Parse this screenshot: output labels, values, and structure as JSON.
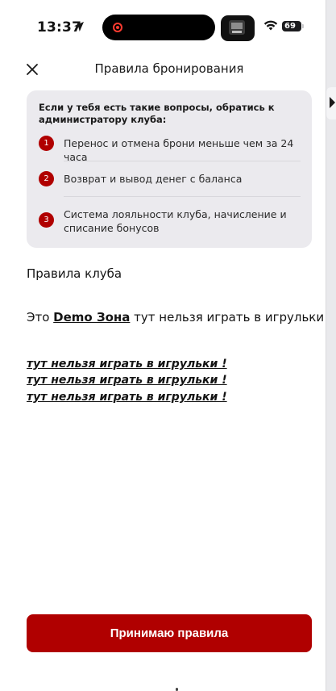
{
  "status_bar": {
    "time": "13:37",
    "battery": "69"
  },
  "header": {
    "title": "Правила бронирования"
  },
  "info_card": {
    "intro": "Если у тебя есть такие вопросы, обратись к администратору клуба:",
    "topics": [
      {
        "number": "1",
        "text": "Перенос и отмена брони меньше чем за 24 часа"
      },
      {
        "number": "2",
        "text": "Возврат и вывод денег с баланса"
      },
      {
        "number": "3",
        "text": "Система лояльности клуба, начисление и списание бонусов"
      }
    ]
  },
  "rules": {
    "heading": "Правила клуба",
    "line_prefix": "Это ",
    "club_name": "Demo Зона",
    "line_suffix": " тут нельзя играть в игрульки !",
    "emphasis_lines": [
      "тут нельзя играть в игрульки !",
      "тут нельзя играть в игрульки !",
      "тут нельзя играть в игрульки !"
    ]
  },
  "accept_button": {
    "label": "Принимаю правила"
  },
  "colors": {
    "accent": "#b00000",
    "card_bg": "#ebeaee",
    "text": "#141414"
  },
  "icons": {
    "close": "close-icon",
    "location": "location-arrow-icon",
    "wifi": "wifi-icon",
    "battery": "battery-icon",
    "side_tab": "chevron-right-icon"
  }
}
